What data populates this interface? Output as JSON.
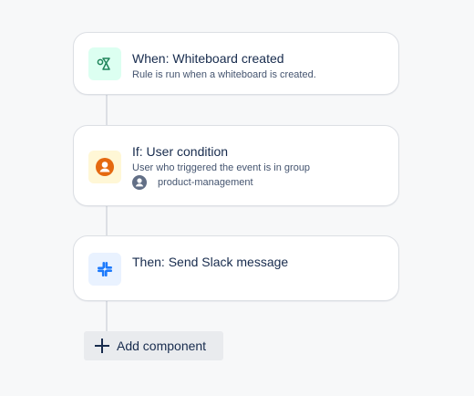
{
  "trigger": {
    "title": "When: Whiteboard created",
    "description": "Rule is run when a whiteboard is created.",
    "icon": "whiteboard-shapes-icon",
    "icon_bg": "#dcfff1",
    "icon_color": "#1f845a"
  },
  "condition": {
    "title": "If: User condition",
    "description": "User who triggered the event is in group",
    "group_name": "product-management",
    "icon": "user-circle-icon",
    "icon_bg": "#fff7d6",
    "icon_color": "#e56910"
  },
  "action": {
    "title": "Then: Send Slack message",
    "icon": "slack-icon",
    "icon_bg": "#e9f2ff",
    "icon_color": "#1d7afc"
  },
  "add_component": {
    "label": "Add component",
    "icon": "plus-icon"
  }
}
